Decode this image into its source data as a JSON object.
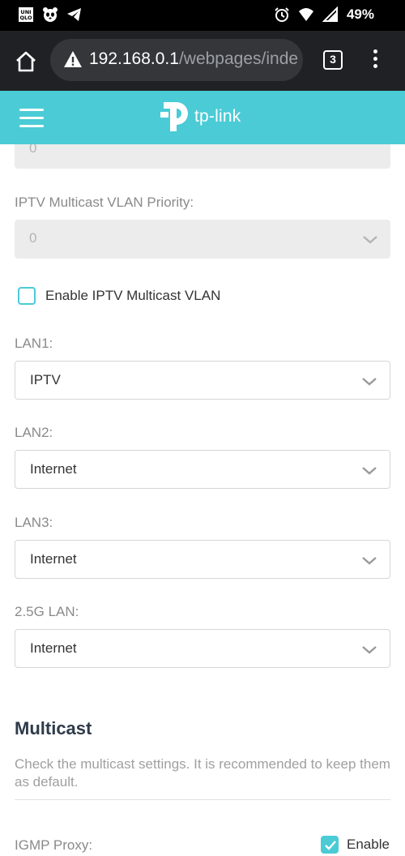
{
  "status_bar": {
    "battery": "49%",
    "left_icons": [
      "uniqlo-app-icon",
      "panda-app-icon",
      "telegram-icon"
    ],
    "right_icons": [
      "alarm-icon",
      "wifi-icon",
      "signal-icon"
    ]
  },
  "browser": {
    "url_host": "192.168.0.1",
    "url_path": "/webpages/inde",
    "tab_count": "3"
  },
  "app": {
    "logo_text": "tp-link",
    "accent_color": "#4acbd6"
  },
  "form": {
    "top_partial_value": "0",
    "multicast_priority": {
      "label": "IPTV Multicast VLAN Priority:",
      "value": "0"
    },
    "enable_multicast_vlan": {
      "label": "Enable IPTV Multicast VLAN",
      "checked": false
    },
    "lan_ports": [
      {
        "label": "LAN1:",
        "value": "IPTV"
      },
      {
        "label": "LAN2:",
        "value": "Internet"
      },
      {
        "label": "LAN3:",
        "value": "Internet"
      },
      {
        "label": "2.5G LAN:",
        "value": "Internet"
      }
    ]
  },
  "multicast": {
    "title": "Multicast",
    "description": "Check the multicast settings. It is recommended to keep them as default.",
    "igmp_proxy": {
      "label": "IGMP Proxy:",
      "toggle_label": "Enable",
      "checked": true
    }
  }
}
